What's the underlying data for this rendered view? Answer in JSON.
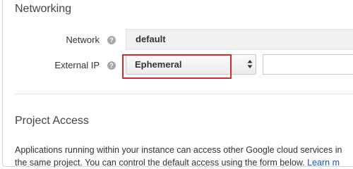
{
  "networking": {
    "title": "Networking",
    "network": {
      "label": "Network",
      "value": "default"
    },
    "external_ip": {
      "label": "External IP",
      "selected": "Ephemeral",
      "address_value": ""
    },
    "help_glyph": "?"
  },
  "project_access": {
    "title": "Project Access",
    "line1": "Applications running within your instance can access other Google cloud services in",
    "line2_prefix": "the same project. You can control the default access using the form below.",
    "learn_more": "Learn m"
  },
  "colors": {
    "highlight": "#d42b2b",
    "link": "#1155cc"
  }
}
